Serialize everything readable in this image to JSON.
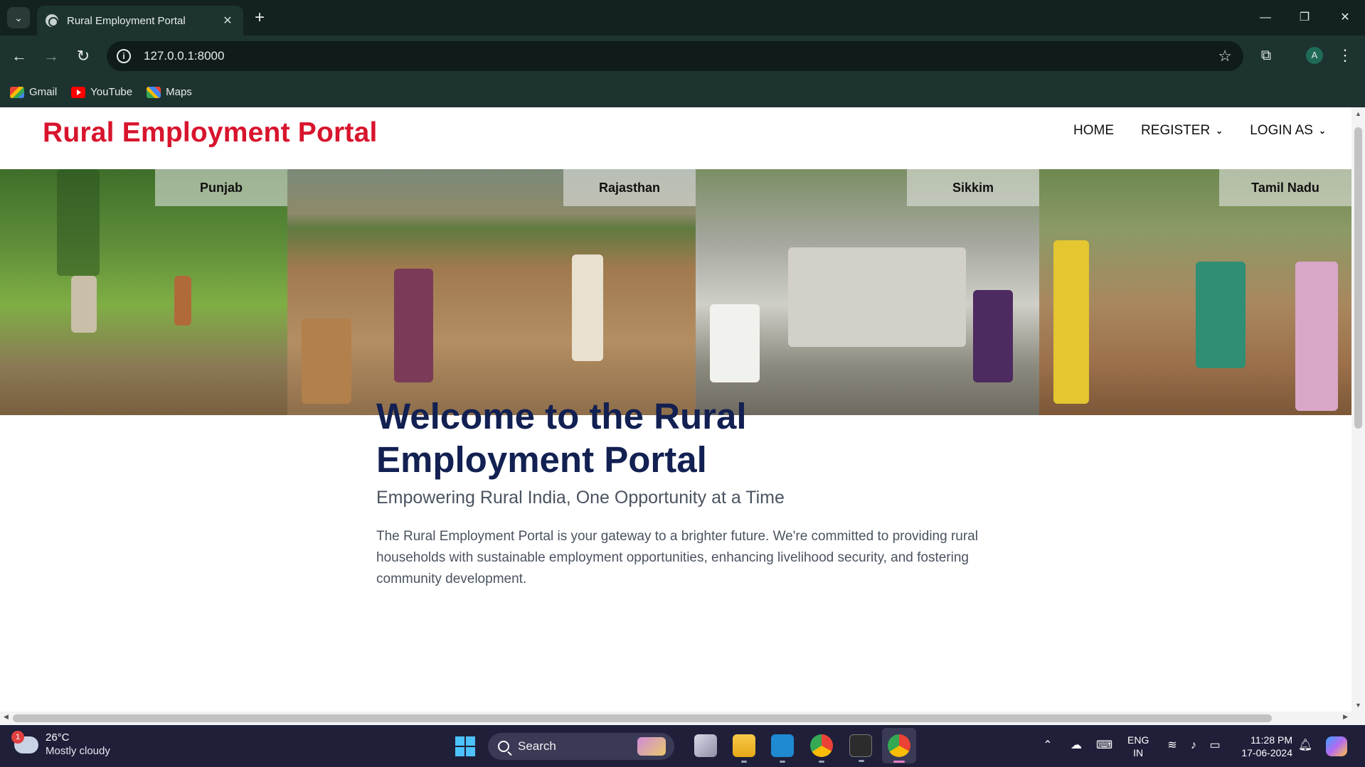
{
  "browser": {
    "tab_title": "Rural Employment Portal",
    "tab_close": "✕",
    "new_tab": "+",
    "url": "127.0.0.1:8000",
    "window_controls": {
      "minimize": "—",
      "restore": "❐",
      "close": "✕"
    },
    "profile_initial": "A",
    "bookmarks": [
      {
        "label": "Gmail",
        "icon": "gmail-icon"
      },
      {
        "label": "YouTube",
        "icon": "youtube-icon"
      },
      {
        "label": "Maps",
        "icon": "maps-icon"
      }
    ]
  },
  "site": {
    "brand": "Rural Employment Portal",
    "brand_color": "#d8142d",
    "nav": {
      "home": "HOME",
      "register": "REGISTER",
      "login_as": "LOGIN AS"
    },
    "banner": {
      "states": [
        "Punjab",
        "Rajasthan",
        "Sikkim",
        "Tamil Nadu"
      ]
    },
    "welcome": {
      "title": "Welcome to the Rural Employment Portal",
      "tagline": "Empowering Rural India, One Opportunity at a Time",
      "description": "The Rural Employment Portal is your gateway to a brighter future. We're committed to providing rural households with sustainable employment opportunities, enhancing livelihood security, and fostering community development."
    },
    "title_color": "#122052"
  },
  "taskbar": {
    "weather": {
      "badge": "1",
      "temp": "26°C",
      "condition": "Mostly cloudy"
    },
    "search_label": "Search",
    "language": {
      "line1": "ENG",
      "line2": "IN"
    },
    "clock": {
      "time": "11:28 PM",
      "date": "17-06-2024"
    }
  }
}
